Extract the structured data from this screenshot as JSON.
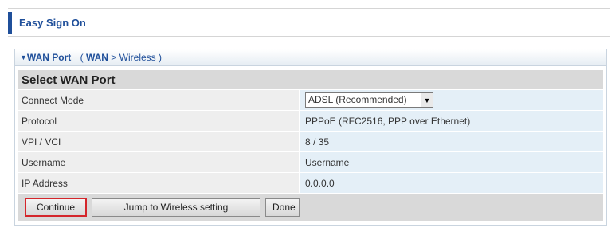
{
  "header": {
    "title": "Easy Sign On"
  },
  "panel": {
    "title": "WAN Port",
    "breadcrumb": {
      "open_paren": "(",
      "current": "WAN",
      "sep": ">",
      "next": "Wireless",
      "close_paren": ")"
    }
  },
  "section": {
    "title": "Select WAN Port"
  },
  "rows": [
    {
      "label": "Connect Mode",
      "value": "ADSL  (Recommended)"
    },
    {
      "label": "Protocol",
      "value": "PPPoE (RFC2516, PPP over Ethernet)"
    },
    {
      "label": "VPI / VCI",
      "value": "8 / 35"
    },
    {
      "label": "Username",
      "value": "Username"
    },
    {
      "label": "IP Address",
      "value": "0.0.0.0"
    }
  ],
  "buttons": {
    "continue": "Continue",
    "jump": "Jump to Wireless setting",
    "done": "Done"
  },
  "colors": {
    "accent": "#1f4f9a",
    "highlight": "#d4262b"
  }
}
